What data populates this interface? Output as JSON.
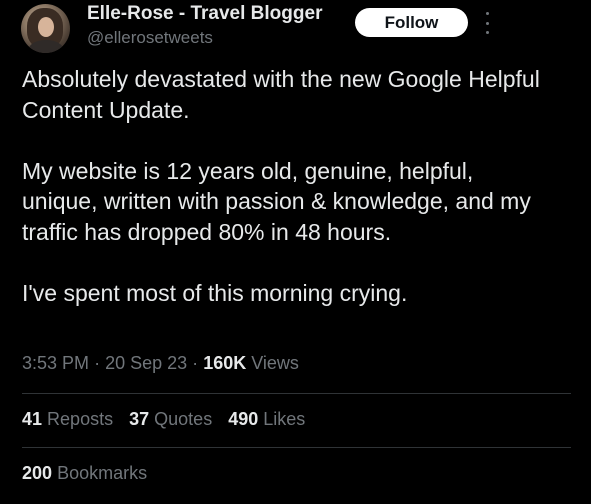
{
  "author": {
    "display_name": "Elle-Rose - Travel Blogger",
    "handle": "@ellerosetweets",
    "avatar_icon": "profile-photo"
  },
  "follow_label": "Follow",
  "more_icon": "more-vertical-icon",
  "tweet": {
    "paragraphs": [
      "Absolutely devastated with the new Google Helpful Content Update.",
      "My website is 12 years old, genuine, helpful, unique, written with passion & knowledge, and my traffic has dropped 80% in 48 hours.",
      "I've spent most of this morning crying."
    ]
  },
  "meta": {
    "time": "3:53 PM",
    "separator": "·",
    "date": "20 Sep 23",
    "views_count": "160K",
    "views_label": "Views"
  },
  "stats": {
    "reposts_count": "41",
    "reposts_label": "Reposts",
    "quotes_count": "37",
    "quotes_label": "Quotes",
    "likes_count": "490",
    "likes_label": "Likes"
  },
  "bookmarks": {
    "count": "200",
    "label": "Bookmarks"
  },
  "colors": {
    "background": "#000000",
    "primary_text": "#e7e9ea",
    "secondary_text": "#71767b",
    "divider": "#2f3336",
    "follow_button": "#ffffff"
  }
}
